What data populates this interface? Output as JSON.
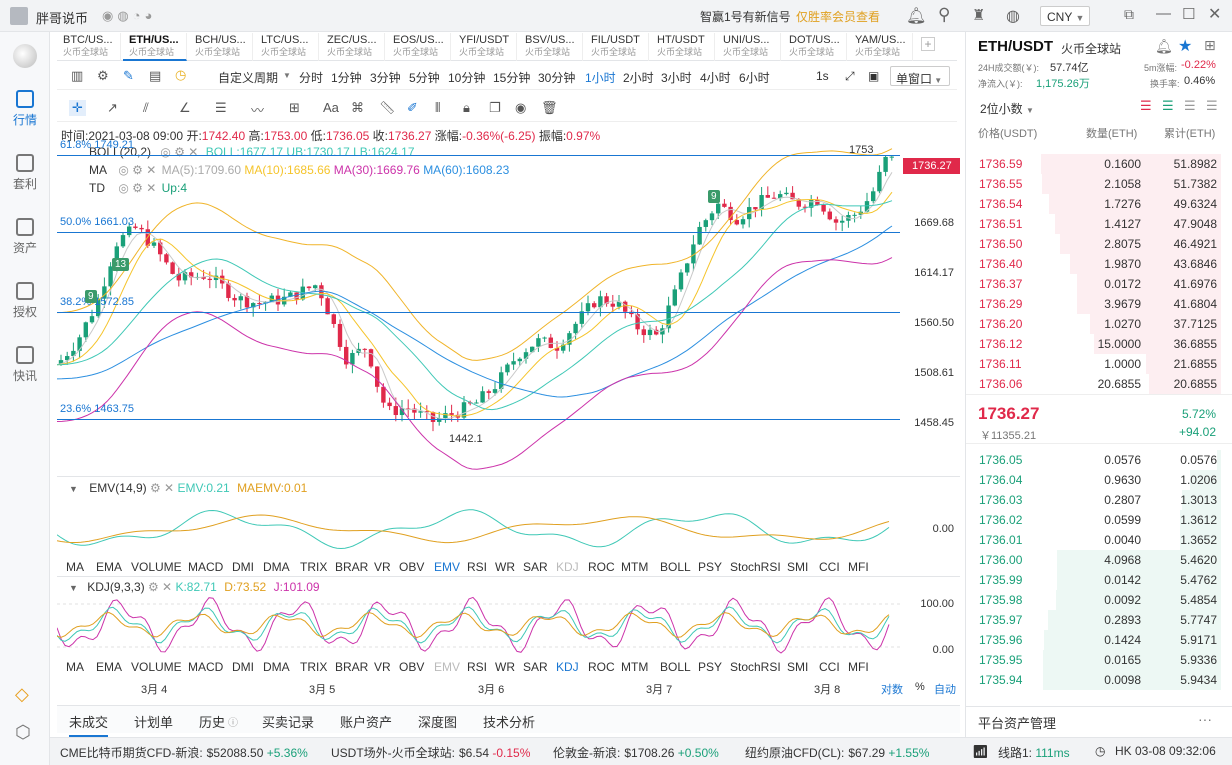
{
  "app": {
    "name": "胖哥说币",
    "notice": "智赢1号有新信号",
    "notice_sub": "仅胜率会员查看",
    "currency": "CNY"
  },
  "nav": [
    {
      "label": "行情"
    },
    {
      "label": "套利"
    },
    {
      "label": "资产"
    },
    {
      "label": "授权"
    },
    {
      "label": "快讯"
    }
  ],
  "tabs": [
    {
      "symbol": "BTC/US...",
      "exchange": "火币全球站"
    },
    {
      "symbol": "ETH/US...",
      "exchange": "火币全球站"
    },
    {
      "symbol": "BCH/US...",
      "exchange": "火币全球站"
    },
    {
      "symbol": "LTC/US...",
      "exchange": "火币全球站"
    },
    {
      "symbol": "ZEC/US...",
      "exchange": "火币全球站"
    },
    {
      "symbol": "EOS/US...",
      "exchange": "火币全球站"
    },
    {
      "symbol": "YFI/USDT",
      "exchange": "火币全球站"
    },
    {
      "symbol": "BSV/US...",
      "exchange": "火币全球站"
    },
    {
      "symbol": "FIL/USDT",
      "exchange": "火币全球站"
    },
    {
      "symbol": "HT/USDT",
      "exchange": "火币全球站"
    },
    {
      "symbol": "UNI/US...",
      "exchange": "火币全球站"
    },
    {
      "symbol": "DOT/US...",
      "exchange": "火币全球站"
    },
    {
      "symbol": "YAM/US...",
      "exchange": "火币全球站"
    }
  ],
  "periods": {
    "custom": "自定义周期",
    "items": [
      "分时",
      "1分钟",
      "3分钟",
      "5分钟",
      "10分钟",
      "15分钟",
      "30分钟",
      "1小时",
      "2小时",
      "3小时",
      "4小时",
      "6小时"
    ],
    "selected": "1小时",
    "sec": "1s",
    "window": "单窗口"
  },
  "draw_tools": {
    "text_tool": "Aa"
  },
  "ohlc": {
    "time": "时间:2021-03-08 09:00",
    "open_label": "开:",
    "open": "1742.40",
    "high_label": "高:",
    "high": "1753.00",
    "low_label": "低:",
    "low": "1736.05",
    "close_label": "收:",
    "close": "1736.27",
    "chg_label": "涨幅:",
    "chg": "-0.36%(-6.25)",
    "amp_label": "振幅:",
    "amp": "0.97%"
  },
  "indicators": {
    "boll": {
      "name": "BOLL(20,2)",
      "text": "BOLL:1677.17  UB:1730.17  LB:1624.17"
    },
    "ma": {
      "name": "MA",
      "ma5": "MA(5):1709.60",
      "ma10": "MA(10):1685.66",
      "ma30": "MA(30):1669.76",
      "ma60": "MA(60):1608.23"
    },
    "td": {
      "name": "TD",
      "val": "Up:4"
    },
    "emv": {
      "name": "EMV(14,9)",
      "emv": "EMV:0.21",
      "maemv": "MAEMV:0.01"
    },
    "kdj": {
      "name": "KDJ(9,3,3)",
      "k": "K:82.71",
      "d": "D:73.52",
      "j": "J:101.09"
    }
  },
  "fib": [
    {
      "label": "61.8% 1749.21"
    },
    {
      "label": "50.0% 1661.03"
    },
    {
      "label": "38.2% 1572.85"
    },
    {
      "label": "23.6% 1463.75"
    }
  ],
  "y_axis": [
    "1669.68",
    "1614.17",
    "1560.50",
    "1508.61",
    "1458.45"
  ],
  "price_tag": "1736.27",
  "marks": {
    "high": "1753",
    "low": "1442.1",
    "td9a": "9",
    "td13": "13",
    "td9b": "9"
  },
  "emv_axis": "0.00",
  "kdj_axis": [
    "100.00",
    "0.00"
  ],
  "indicator_tabs": [
    "MA",
    "EMA",
    "VOLUME",
    "MACD",
    "DMI",
    "DMA",
    "TRIX",
    "BRAR",
    "VR",
    "OBV",
    "EMV",
    "RSI",
    "WR",
    "SAR",
    "KDJ",
    "ROC",
    "MTM",
    "BOLL",
    "PSY",
    "StochRSI",
    "SMI",
    "CCI",
    "MFI"
  ],
  "x_axis": [
    "3月 4",
    "3月 5",
    "3月 6",
    "3月 7",
    "3月 8"
  ],
  "x_right": {
    "log": "对数",
    "pct": "%",
    "auto": "自动"
  },
  "bottom_tabs": [
    "未成交",
    "计划单",
    "历史",
    "买卖记录",
    "账户资产",
    "深度图",
    "技术分析"
  ],
  "right": {
    "pair": "ETH/USDT",
    "exchange": "火币全球站",
    "vol_label": "24H成交额(￥):",
    "vol": "57.74亿",
    "inflow_label": "净流入(￥):",
    "inflow": "1,175.26万",
    "m5_label": "5m涨幅:",
    "m5": "-0.22%",
    "turn_label": "换手率:",
    "turn": "0.46%",
    "decimals": "2位小数",
    "headers": [
      "价格(USDT)",
      "数量(ETH)",
      "累计(ETH)"
    ],
    "asks": [
      {
        "p": "1736.59",
        "q": "0.1600",
        "c": "51.8982"
      },
      {
        "p": "1736.55",
        "q": "2.1058",
        "c": "51.7382"
      },
      {
        "p": "1736.54",
        "q": "1.7276",
        "c": "49.6324"
      },
      {
        "p": "1736.51",
        "q": "1.4127",
        "c": "47.9048"
      },
      {
        "p": "1736.50",
        "q": "2.8075",
        "c": "46.4921"
      },
      {
        "p": "1736.40",
        "q": "1.9870",
        "c": "43.6846"
      },
      {
        "p": "1736.37",
        "q": "0.0172",
        "c": "41.6976"
      },
      {
        "p": "1736.29",
        "q": "3.9679",
        "c": "41.6804"
      },
      {
        "p": "1736.20",
        "q": "1.0270",
        "c": "37.7125"
      },
      {
        "p": "1736.12",
        "q": "15.0000",
        "c": "36.6855"
      },
      {
        "p": "1736.11",
        "q": "1.0000",
        "c": "21.6855"
      },
      {
        "p": "1736.06",
        "q": "20.6855",
        "c": "20.6855"
      }
    ],
    "last": "1736.27",
    "last_cny": "￥11355.21",
    "chg_pct": "5.72%",
    "chg_abs": "+94.02",
    "bids": [
      {
        "p": "1736.05",
        "q": "0.0576",
        "c": "0.0576"
      },
      {
        "p": "1736.04",
        "q": "0.9630",
        "c": "1.0206"
      },
      {
        "p": "1736.03",
        "q": "0.2807",
        "c": "1.3013"
      },
      {
        "p": "1736.02",
        "q": "0.0599",
        "c": "1.3612"
      },
      {
        "p": "1736.01",
        "q": "0.0040",
        "c": "1.3652"
      },
      {
        "p": "1736.00",
        "q": "4.0968",
        "c": "5.4620"
      },
      {
        "p": "1735.99",
        "q": "0.0142",
        "c": "5.4762"
      },
      {
        "p": "1735.98",
        "q": "0.0092",
        "c": "5.4854"
      },
      {
        "p": "1735.97",
        "q": "0.2893",
        "c": "5.7747"
      },
      {
        "p": "1735.96",
        "q": "0.1424",
        "c": "5.9171"
      },
      {
        "p": "1735.95",
        "q": "0.0165",
        "c": "5.9336"
      },
      {
        "p": "1735.94",
        "q": "0.0098",
        "c": "5.9434"
      }
    ],
    "footer": "平台资产管理",
    "more": "···"
  },
  "ticker": [
    {
      "name": "CME比特币期货CFD-新浪:",
      "price": "$52088.50",
      "chg": "+5.36%",
      "dir": "up"
    },
    {
      "name": "USDT场外-火币全球站:",
      "price": "$6.54",
      "chg": "-0.15%",
      "dir": "down"
    },
    {
      "name": "伦敦金-新浪:",
      "price": "$1708.26",
      "chg": "+0.50%",
      "dir": "up"
    },
    {
      "name": "纽约原油CFD(CL):",
      "price": "$67.29",
      "chg": "+1.55%",
      "dir": "up"
    }
  ],
  "status": {
    "line": "线路1:",
    "ms": "111ms",
    "time": "HK 03-08 09:32:06"
  },
  "colors": {
    "accent": "#1976d2",
    "up": "#1aa079",
    "down": "#e0294a",
    "ma5": "#c9c9c9",
    "ma10": "#f5c42b",
    "ma30": "#3fc8b6",
    "ma60": "#2c8fe0",
    "boll": "#f0b429",
    "td": "#3a9a6a",
    "fib": "#1976d2",
    "lb": "#cc33aa"
  }
}
